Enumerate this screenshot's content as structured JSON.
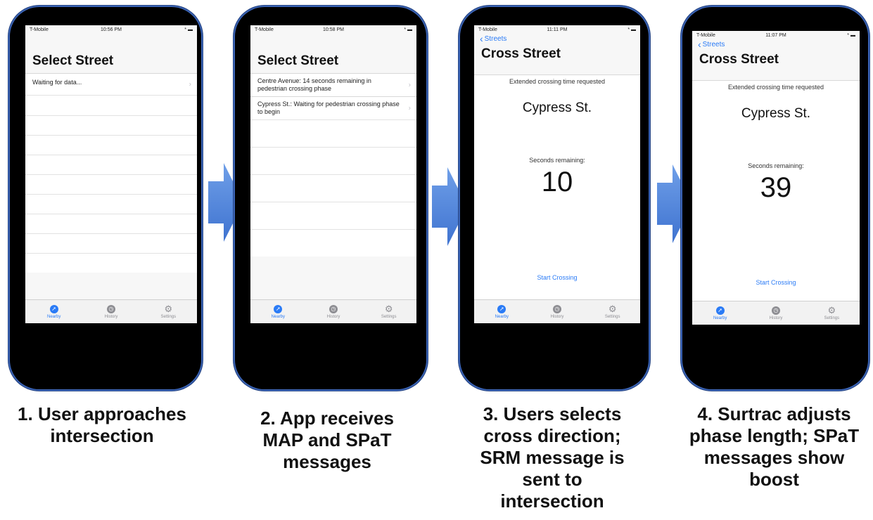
{
  "colors": {
    "accent": "#2a7bf6",
    "arrow": "#4f86e0",
    "phone": "#000000"
  },
  "tabs": [
    {
      "label": "Nearby",
      "icon": "compass-icon"
    },
    {
      "label": "History",
      "icon": "clock-icon"
    },
    {
      "label": "Settings",
      "icon": "gear-icon"
    }
  ],
  "phones": [
    {
      "status": {
        "carrier": "T-Mobile",
        "time": "10:56 PM",
        "battery": "*"
      },
      "title": "Select Street",
      "rows": [
        "Waiting for data..."
      ]
    },
    {
      "status": {
        "carrier": "T-Mobile",
        "time": "10:58 PM",
        "battery": "*"
      },
      "title": "Select Street",
      "rows": [
        "Centre Avenue: 14 seconds remaining in pedestrian crossing phase",
        "Cypress St.: Waiting for pedestrian crossing phase to begin"
      ]
    },
    {
      "status": {
        "carrier": "T-Mobile",
        "time": "11:11 PM",
        "battery": "*"
      },
      "back": "Streets",
      "title": "Cross Street",
      "extended": "Extended crossing time requested",
      "street": "Cypress St.",
      "seconds_label": "Seconds remaining:",
      "seconds": "10",
      "start": "Start Crossing"
    },
    {
      "status": {
        "carrier": "T-Mobile",
        "time": "11:07 PM",
        "battery": "*"
      },
      "back": "Streets",
      "title": "Cross Street",
      "extended": "Extended crossing time requested",
      "street": "Cypress St.",
      "seconds_label": "Seconds remaining:",
      "seconds": "39",
      "start": "Start Crossing"
    }
  ],
  "captions": [
    [
      "1. User approaches",
      "intersection"
    ],
    [
      "2. App receives",
      "MAP and SPaT",
      "messages"
    ],
    [
      "3. Users selects",
      "cross direction;",
      "SRM message is",
      "sent to",
      "intersection"
    ],
    [
      "4. Surtrac adjusts",
      "phase length; SPaT",
      "messages show",
      "boost"
    ]
  ]
}
